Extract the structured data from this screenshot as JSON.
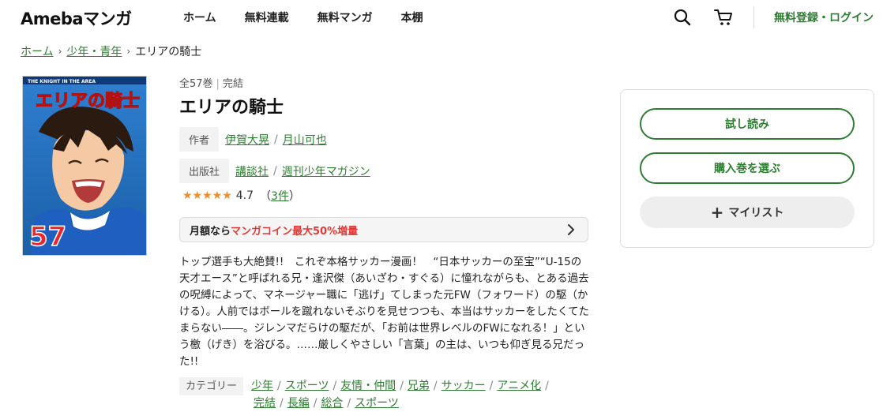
{
  "header": {
    "logo": "Amebaマンガ",
    "nav": [
      "ホーム",
      "無料連載",
      "無料マンガ",
      "本棚"
    ],
    "login": "無料登録・ログイン",
    "icons": [
      "search-icon",
      "cart-icon"
    ]
  },
  "breadcrumb": {
    "items": [
      "ホーム",
      "少年・青年"
    ],
    "current": "エリアの騎士"
  },
  "book": {
    "meta_volumes": "全57巻",
    "meta_status": "完結",
    "title": "エリアの騎士",
    "author_tag": "作者",
    "authors": [
      "伊賀大晃",
      "月山可也"
    ],
    "publisher_tag": "出版社",
    "publishers": [
      "講談社",
      "週刊少年マガジン"
    ],
    "rating_value": "4.7",
    "rating_count_open": "（",
    "rating_count": "3件",
    "rating_count_close": "）",
    "rating_fraction": 0.94,
    "cover_text": {
      "series_en": "THE KNIGHT IN THE AREA",
      "title": "エリアの騎士",
      "volume": "57"
    }
  },
  "promo": {
    "prefix": "月額なら",
    "highlight": "マンガコイン最大50%増量"
  },
  "description": "トップ選手も大絶賛!!　これぞ本格サッカー漫画！　“日本サッカーの至宝”“U-15の天才エース”と呼ばれる兄・逢沢傑（あいざわ・すぐる）に憧れながらも、とある過去の呪縛によって、マネージャー職に「逃げ」てしまった元FW（フォワード）の駆（かける）。人前ではボールを蹴れないそぶりを見せつつも、本当はサッカーをしたくてたまらない――。ジレンマだらけの駆だが、「お前は世界レベルのFWになれる！」という檄（げき）を浴びる。……厳しくやさしい「言葉」の主は、いつも仰ぎ見る兄だった!!",
  "categories": {
    "label": "カテゴリー",
    "line1": [
      "少年",
      "スポーツ",
      "友情・仲間",
      "兄弟",
      "サッカー",
      "アニメ化"
    ],
    "line2": [
      "完結",
      "長編",
      "総合",
      "スポーツ"
    ]
  },
  "panel": {
    "trial": "試し読み",
    "buy": "購入巻を選ぶ",
    "mylist": "マイリスト"
  },
  "colors": {
    "brand_green": "#2e7d32",
    "promo_red": "#e53935",
    "star": "#f28c28"
  }
}
